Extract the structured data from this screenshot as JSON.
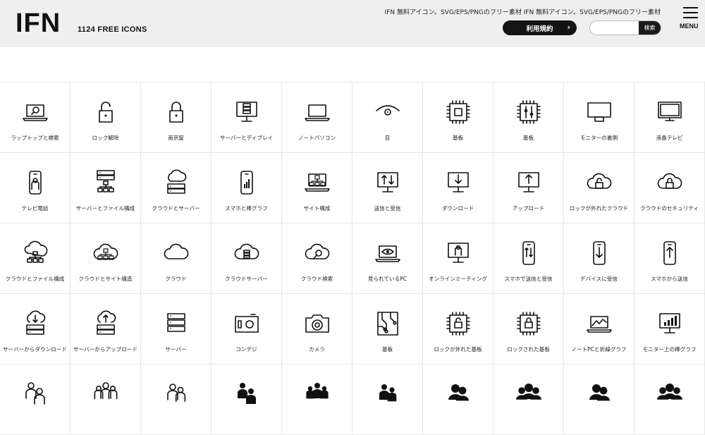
{
  "header": {
    "logo": "IFN",
    "icon_count": "1124 FREE ICONS",
    "tagline": "IFN 無料アイコン。SVG/EPS/PNGのフリー素材 IFN 無料アイコン。SVG/EPS/PNGのフリー素材",
    "terms_label": "利用規約",
    "search_placeholder": "",
    "search_button": "検索",
    "menu_label": "MENU"
  },
  "grid": {
    "items": [
      {
        "label": "ラップトップと検索",
        "icon": "laptop-search-icon"
      },
      {
        "label": "ロック解除",
        "icon": "unlock-icon"
      },
      {
        "label": "南京錠",
        "icon": "padlock-icon"
      },
      {
        "label": "サーバーとディプレイ",
        "icon": "server-display-icon"
      },
      {
        "label": "ノートパソコン",
        "icon": "laptop-icon"
      },
      {
        "label": "目",
        "icon": "eye-icon"
      },
      {
        "label": "基板",
        "icon": "chip-icon"
      },
      {
        "label": "基板",
        "icon": "circuit-chip-icon"
      },
      {
        "label": "モニターの裏側",
        "icon": "monitor-back-icon"
      },
      {
        "label": "液晶テレビ",
        "icon": "lcd-tv-icon"
      },
      {
        "label": "テレビ電話",
        "icon": "video-phone-icon"
      },
      {
        "label": "サーバーとファイル構成",
        "icon": "server-file-tree-icon"
      },
      {
        "label": "クラウドとサーバー",
        "icon": "cloud-server-icon"
      },
      {
        "label": "スマホと棒グラフ",
        "icon": "phone-bar-chart-icon"
      },
      {
        "label": "サイト構成",
        "icon": "site-structure-icon"
      },
      {
        "label": "送信と受信",
        "icon": "send-receive-icon"
      },
      {
        "label": "ダウンロード",
        "icon": "download-icon"
      },
      {
        "label": "アップロード",
        "icon": "upload-icon"
      },
      {
        "label": "ロックが外れたクラウド",
        "icon": "cloud-unlocked-icon"
      },
      {
        "label": "クラウドのセキュリティ",
        "icon": "cloud-security-icon"
      },
      {
        "label": "クラウドとファイル構成",
        "icon": "cloud-file-tree-icon"
      },
      {
        "label": "クラウドとサイト構造",
        "icon": "cloud-site-structure-icon"
      },
      {
        "label": "クラウド",
        "icon": "cloud-icon"
      },
      {
        "label": "クラウドサーバー",
        "icon": "cloud-server-2-icon"
      },
      {
        "label": "クラウド検索",
        "icon": "cloud-search-icon"
      },
      {
        "label": "見られているPC",
        "icon": "watched-pc-icon"
      },
      {
        "label": "オンラインミーティング",
        "icon": "online-meeting-icon"
      },
      {
        "label": "スマホで送信と受信",
        "icon": "phone-send-receive-icon"
      },
      {
        "label": "デバイスに受信",
        "icon": "device-receive-icon"
      },
      {
        "label": "スマホから送信",
        "icon": "phone-send-icon"
      },
      {
        "label": "サーバーからダウンロード",
        "icon": "server-download-icon"
      },
      {
        "label": "サーバーからアップロード",
        "icon": "server-upload-icon"
      },
      {
        "label": "サーバー",
        "icon": "server-icon"
      },
      {
        "label": "コンデジ",
        "icon": "compact-camera-icon"
      },
      {
        "label": "カメラ",
        "icon": "camera-icon"
      },
      {
        "label": "基板",
        "icon": "circuit-board-icon"
      },
      {
        "label": "ロックが外れた基板",
        "icon": "chip-unlocked-icon"
      },
      {
        "label": "ロックされた基板",
        "icon": "chip-locked-icon"
      },
      {
        "label": "ノートPCと折線グラフ",
        "icon": "laptop-line-chart-icon"
      },
      {
        "label": "モニター上の棒グラフ",
        "icon": "monitor-bar-chart-icon"
      },
      {
        "label": "",
        "icon": "people-outline-icon"
      },
      {
        "label": "",
        "icon": "group-outline-icon"
      },
      {
        "label": "",
        "icon": "pair-outline-icon"
      },
      {
        "label": "",
        "icon": "people-solid-icon"
      },
      {
        "label": "",
        "icon": "group-solid-icon"
      },
      {
        "label": "",
        "icon": "pair-solid-icon"
      },
      {
        "label": "",
        "icon": "user-pair-solid-icon"
      },
      {
        "label": "",
        "icon": "team-solid-icon"
      },
      {
        "label": "",
        "icon": "user-pair-solid-2-icon"
      },
      {
        "label": "",
        "icon": "team-solid-2-icon"
      }
    ]
  }
}
